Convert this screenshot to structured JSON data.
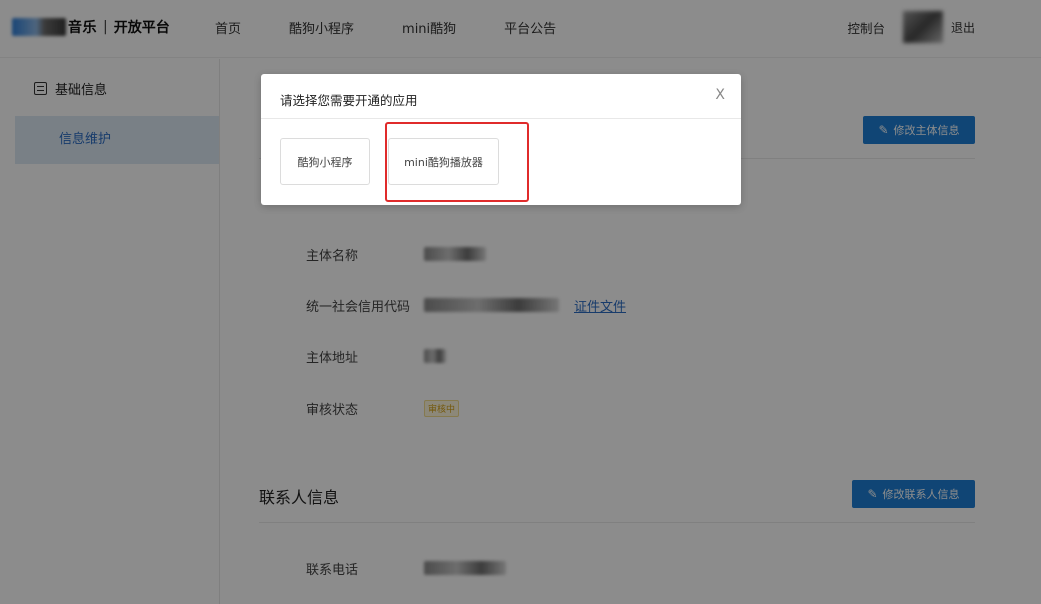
{
  "header": {
    "logo_text": "音乐",
    "logo_separator": "|",
    "logo_subtitle": "开放平台",
    "nav": [
      "首页",
      "酷狗小程序",
      "mini酷狗",
      "平台公告"
    ],
    "console_label": "控制台",
    "logout_label": "退出"
  },
  "sidebar": {
    "section_title": "基础信息",
    "items": [
      {
        "label": "信息维护",
        "active": true
      }
    ]
  },
  "main": {
    "subject": {
      "edit_button": "修改主体信息",
      "rows": [
        {
          "label": "主体名称"
        },
        {
          "label": "统一社会信用代码",
          "link": "证件文件"
        },
        {
          "label": "主体地址"
        },
        {
          "label": "审核状态",
          "badge": "审核中"
        }
      ]
    },
    "contact": {
      "title": "联系人信息",
      "edit_button": "修改联系人信息",
      "rows": [
        {
          "label": "联系电话"
        }
      ]
    }
  },
  "modal": {
    "title": "请选择您需要开通的应用",
    "close_label": "X",
    "options": [
      "酷狗小程序",
      "mini酷狗播放器"
    ]
  },
  "colors": {
    "primary": "#1e7fd6",
    "active_bg": "#dce9f5",
    "highlight": "#e02b2b",
    "badge_text": "#d4a017"
  }
}
